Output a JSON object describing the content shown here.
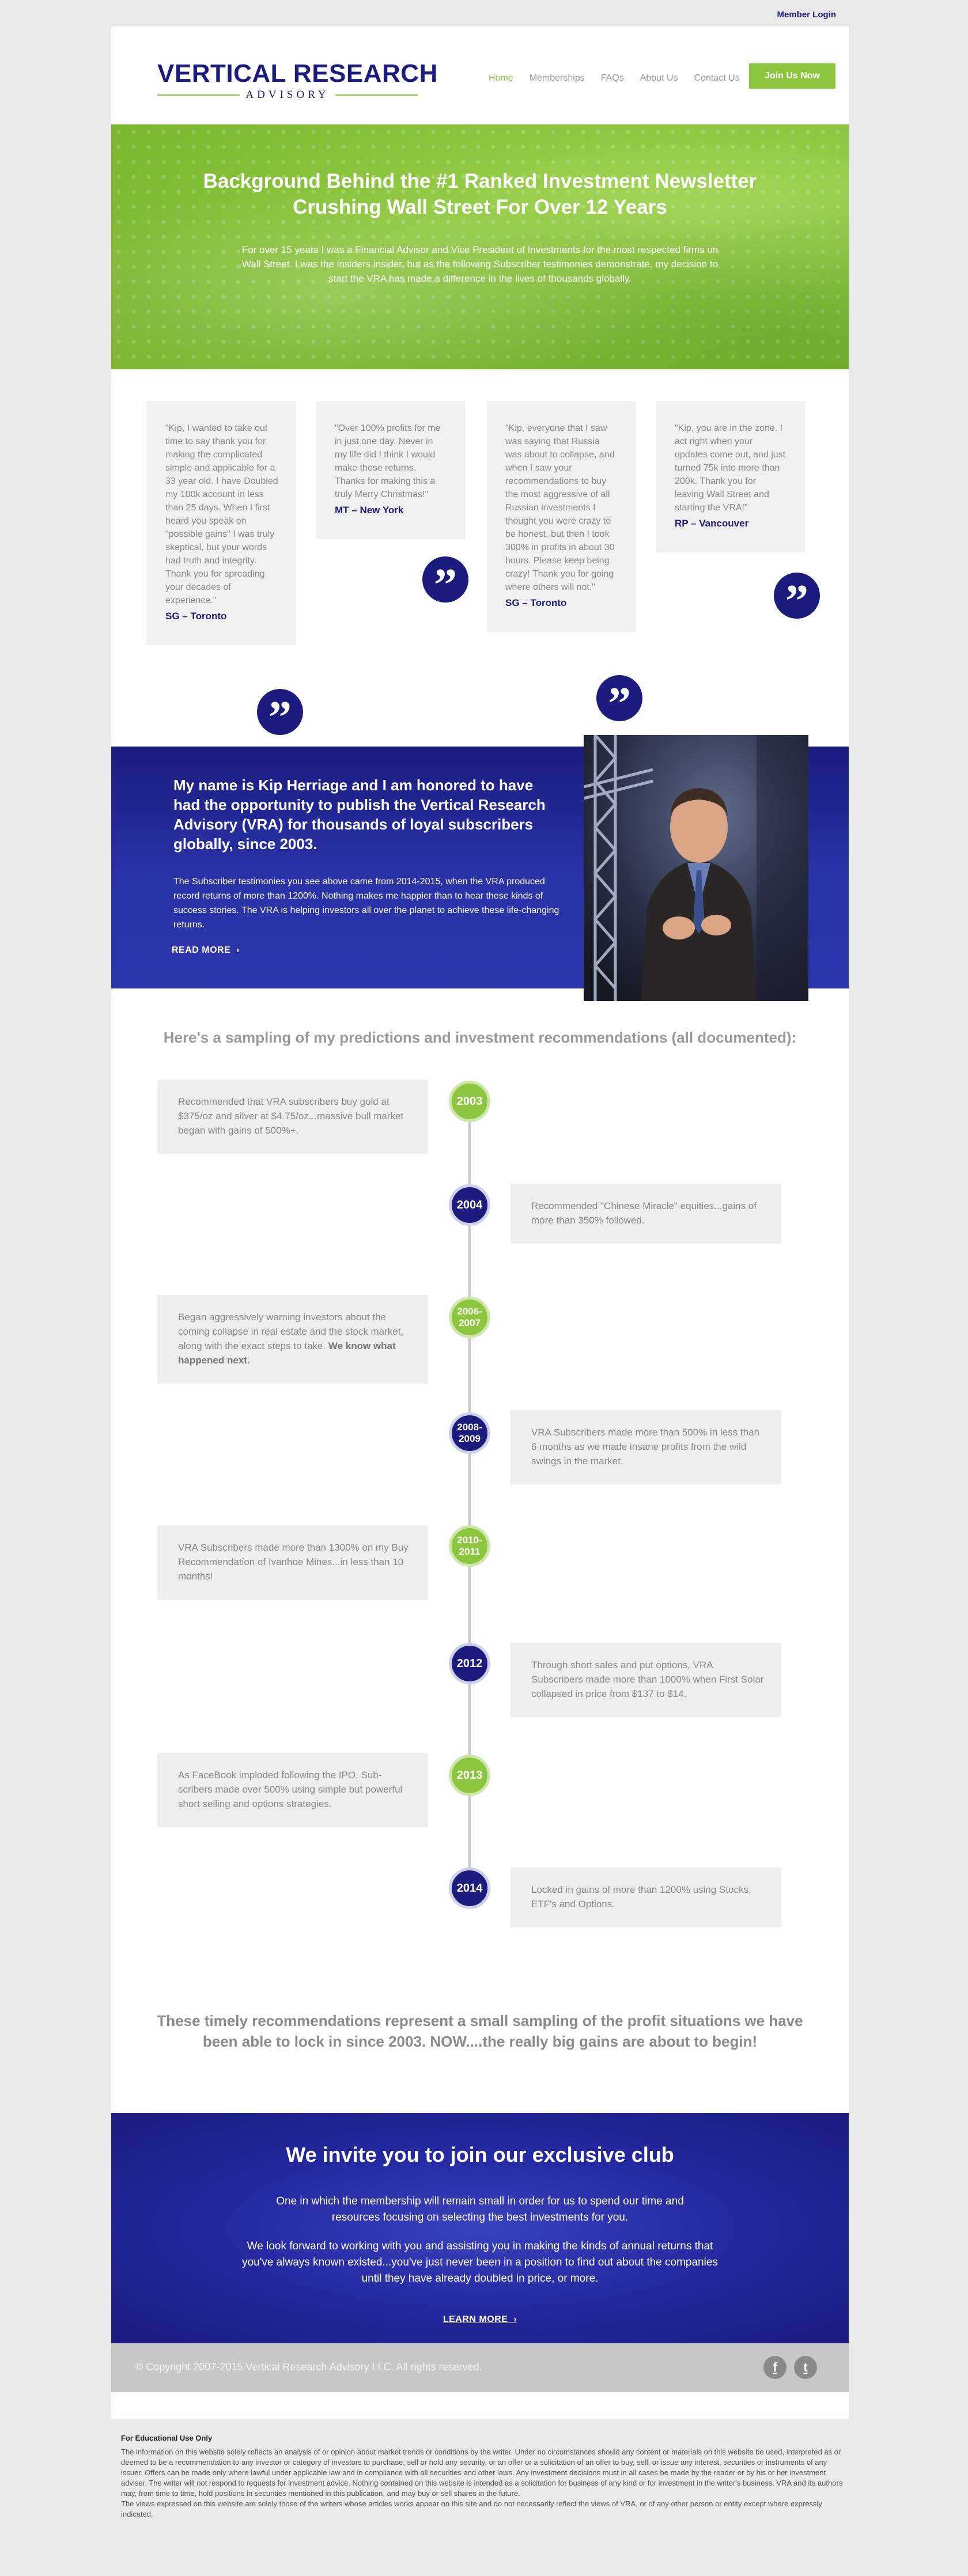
{
  "header": {
    "member_login": "Member Login",
    "logo_top": "VERTICAL RESEARCH",
    "logo_sub": "ADVISORY",
    "nav": [
      "Home",
      "Memberships",
      "FAQs",
      "About Us",
      "Contact Us"
    ],
    "join_label": "Join Us Now"
  },
  "hero": {
    "title_line1": "Background Behind the #1 Ranked Investment Newsletter",
    "title_line2": "Crushing Wall Street For Over 12 Years",
    "text": "For over 15 years I was a Financial Advisor and Vice President of Investments for the most respected firms on Wall Street. I was the insiders insider, but as the following Subscriber testimonies demonstrate, my decision to start the VRA has made a difference in the lives of thousands globally."
  },
  "testimonials": [
    {
      "quote": "\"Kip, I wanted to take out time to say thank you for making the complicated simple and applicable for a 33 year old. I have Dou­bled my 100k account in less than 25 days. When I first heard you speak on \"possible gains\" I was truly skep­tical, but your words had truth and integrity. Thank you for spread­ing your decades of experience.\"",
      "author": "SG – Toronto"
    },
    {
      "quote": "\"Over 100% profits for me in just one day. Never in my life did I think I would make these returns. Thanks for making this a truly Merry Christmas!\"",
      "author": "MT – New York"
    },
    {
      "quote": "\"Kip, everyone that I saw was saying that Russia was about to collapse, and when I saw your recommenda­tions to buy the most aggressive of all Rus­sian investments I thought you were crazy to be honest, but then I took 300% in profits in about 30 hours. Please keep being crazy! Thank you for going where others will not.\"",
      "author": "SG – Toronto"
    },
    {
      "quote": "\"Kip, you are in the zone. I act right when your updates come out, and just turned 75k into more than 200k. Thank you for leaving Wall Street and starting the VRA!\"",
      "author": "RP – Vancouver"
    }
  ],
  "bio": {
    "heading": "My name is Kip Herriage and I am honored to have had the opportunity to publish the Vertical Research Advisory (VRA) for thousands of loyal subscribers globally, since 2003.",
    "text": "The Subscriber testimonies you see above came from 2014-2015, when the VRA produced record returns of more than 1200%. Nothing makes me happier than to hear these kinds of success stories. The VRA is helping investors all over the planet to achieve these life-changing returns.",
    "read_more": "READ MORE"
  },
  "timeline": {
    "heading": "Here's a sampling of my predictions and investment recommendations (all documented):",
    "items": [
      {
        "year": "2003",
        "text": "Recommended that VRA subscribers buy gold at $375/oz and silver at $4.75/oz...massive bull market began with gains of 500%+.",
        "bold": ""
      },
      {
        "year": "2004",
        "text": "Recommended \"Chinese Miracle\" equities...gains of more than 350% followed.",
        "bold": ""
      },
      {
        "year": "2006-2007",
        "text": "Began aggressively warning investors about the coming collapse in real estate and the stock market, along with the exact steps to take.",
        "bold": "We know what happened next."
      },
      {
        "year": "2008-2009",
        "text": "VRA Subscribers made more than 500% in less than 6 months as we made insane profits from the wild swings in the market.",
        "bold": ""
      },
      {
        "year": "2010-2011",
        "text": "VRA Subscribers made more than 1300% on my Buy Recommendation of Ivanhoe Mines...in less than 10 months!",
        "bold": ""
      },
      {
        "year": "2012",
        "text": "Through short sales and put options, VRA Subscribers made more than 1000% when First Solar collapsed in price from $137 to $14.",
        "bold": ""
      },
      {
        "year": "2013",
        "text": "As FaceBook imploded following the IPO, Sub­scribers made over 500% using simple but pow­erful short selling and options strategies.",
        "bold": ""
      },
      {
        "year": "2014",
        "text": "Locked in gains of more than 1200% using Stocks, ETF's and Options.",
        "bold": ""
      }
    ],
    "tagline": "These timely recommendations represent a small sampling of the profit situations we have been able to lock in since 2003. NOW....the really big gains are about to begin!"
  },
  "invite": {
    "title": "We invite you to join our exclusive club",
    "p1": "One in which the membership will remain small in order for us to spend our time and resources focusing on selecting the best investments for you.",
    "p2": "We look forward to working with you and assisting you in making the kinds of annual returns that you've always known existed...you've just never been in a position to find out about the companies until they have already doubled in price, or more.",
    "learn_more": "LEARN MORE"
  },
  "footer": {
    "copyright": "© Copyright 2007-2015 Vertical Research Advisory LLC. All rights reserved.",
    "social": [
      "f",
      "t"
    ]
  },
  "disclaimer": {
    "heading": "For Educational Use Only",
    "p1": "The information on this website solely reflects an analysis of or opinion about market trends or conditions by the writer. Under no circumstances should any content or materials on this website be used, interpreted as or deemed to be a recommendation to any investor or category of investors to purchase, sell or hold any security, or an offer or a solicitation of an offer to buy, sell, or issue any interest, securities or instruments of any issuer. Offers can be made only where lawful under applicable law and in compliance with all securities and other laws. Any investment decisions must in all cases be made by the reader or by his or her investment adviser. The writer will not respond to requests for investment advice. Nothing contained on this website is intended as a solicitation for business of any kind or for investment in the writer's business. VRA and its authors may, from time to time, hold positions in securities mentioned in this publication, and may buy or sell shares in the future.",
    "p2": "The views expressed on this website are solely those of the writers whose articles works appear on this site and do not necessarily reflect the views of VRA, or of any other person or entity except where expressly indicated."
  },
  "colors": {
    "navy": "#1b1c7e",
    "green": "#8cc63f"
  }
}
